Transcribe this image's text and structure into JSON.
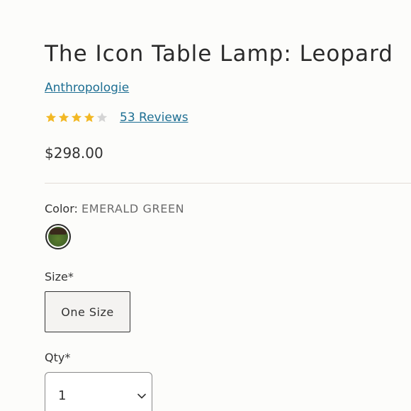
{
  "product": {
    "title": "The Icon Table Lamp: Leopard",
    "brand": "Anthropologie",
    "rating": 4,
    "rating_max": 5,
    "reviews_label": "53 Reviews",
    "price": "$298.00"
  },
  "options": {
    "color_label": "Color:",
    "color_value": "EMERALD GREEN",
    "size_label": "Size*",
    "size_value": "One Size",
    "qty_label": "Qty*",
    "qty_value": "1"
  },
  "colors": {
    "link": "#1e6f93",
    "star_filled": "#f2b824",
    "star_empty": "#d4d4d4",
    "swatch": "#46662a"
  },
  "icons": {
    "star": "star-icon",
    "chevron": "chevron-down-icon"
  }
}
